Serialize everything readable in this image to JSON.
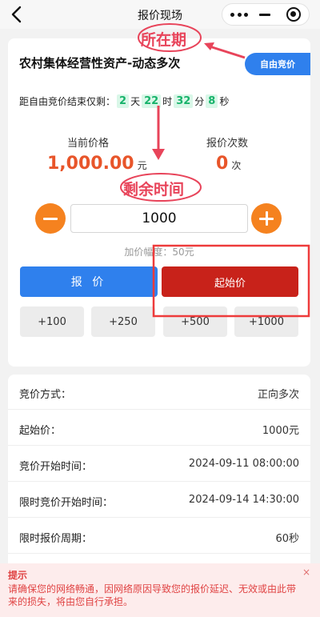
{
  "nav": {
    "title": "报价现场"
  },
  "auction": {
    "title": "农村集体经营性资产-动态多次",
    "tag": "自由竞价",
    "countdown": {
      "prefix": "距自由竞价结束仅剩：",
      "days": "2",
      "days_unit": "天",
      "hours": "22",
      "hours_unit": "时",
      "minutes": "32",
      "minutes_unit": "分",
      "seconds": "8",
      "seconds_unit": "秒"
    },
    "current_price_label": "当前价格",
    "current_price": "1,000.00",
    "current_price_unit": "元",
    "bid_count_label": "报价次数",
    "bid_count": "0",
    "bid_count_unit": "次",
    "quantity_value": "1000",
    "increment_note": "加价幅度：50元",
    "bid_button": "报 价",
    "start_button": "起始价",
    "increments": [
      "+100",
      "+250",
      "+500",
      "+1000"
    ]
  },
  "info": [
    {
      "label": "竞价方式：",
      "value": "正向多次"
    },
    {
      "label": "起始价：",
      "value": "1000元"
    },
    {
      "label": "竞价开始时间：",
      "value": "2024-09-11 08:00:00"
    },
    {
      "label": "限时竞价开始时间：",
      "value": "2024-09-14 14:30:00"
    },
    {
      "label": "限时报价周期：",
      "value": "60秒"
    }
  ],
  "tip": {
    "title": "提示",
    "text": "请确保您的网络畅通，因网络原因导致您的报价延迟、无效或由此带来的损失，将由您自行承担。",
    "close": "×"
  },
  "annotations": {
    "period_label": "所在期",
    "remaining_label": "剩余时间"
  },
  "colors": {
    "accent_blue": "#2f80ed",
    "start_red": "#c8221a",
    "price_orange": "#e8552a",
    "stepper_orange": "#f5821f",
    "countdown_green": "#18b36b",
    "annotation_pink": "#e8445a"
  },
  "icons": {
    "back": "back-arrow-icon",
    "more": "more-dots-icon",
    "minimize": "minimize-icon",
    "close_target": "target-close-icon",
    "minus": "minus-icon",
    "plus": "plus-icon"
  }
}
